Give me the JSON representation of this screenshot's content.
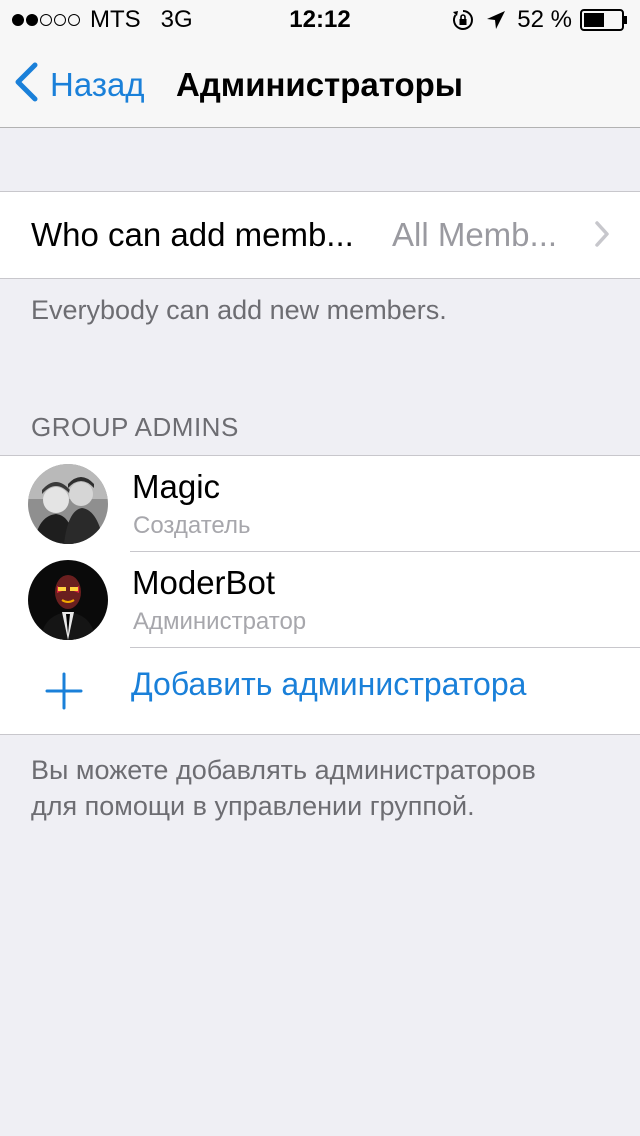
{
  "status_bar": {
    "carrier": "MTS",
    "network": "3G",
    "time": "12:12",
    "battery": "52 %",
    "signal_bars_filled": 2,
    "signal_bars_total": 5
  },
  "nav": {
    "back_label": "Назад",
    "title": "Администраторы"
  },
  "settings": {
    "label": "Who can add memb...",
    "value": "All Memb..."
  },
  "footnote_members": "Everybody can add new members.",
  "section_header": "GROUP ADMINS",
  "admins": [
    {
      "name": "Magic",
      "role": "Создатель"
    },
    {
      "name": "ModerBot",
      "role": "Администратор"
    }
  ],
  "add_admin_label": "Добавить администратора",
  "footnote_admins_line1": "Вы можете добавлять администраторов",
  "footnote_admins_line2": "для помощи в управлении группой.",
  "colors": {
    "accent": "#1a80d9",
    "background": "#efeff4",
    "secondary_text": "#6d6d72"
  }
}
